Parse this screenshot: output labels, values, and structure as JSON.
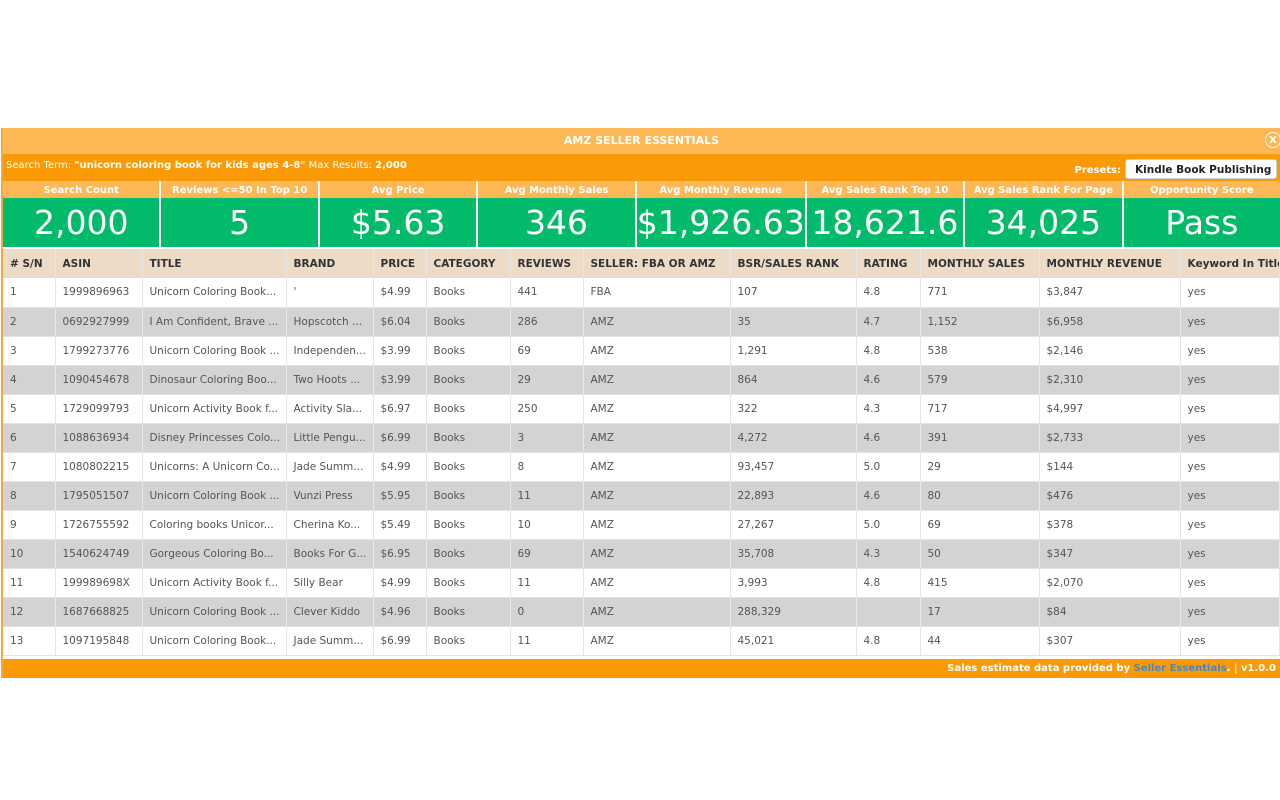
{
  "app": {
    "title": "AMZ SELLER ESSENTIALS",
    "close_label": "X"
  },
  "search": {
    "term_label": "Search Term: ",
    "term_value": "\"unicorn coloring book for kids ages 4-8\"",
    "max_label": " Max Results: ",
    "max_value": "2,000",
    "presets_label": "Presets:",
    "presets_value": "Kindle Book Publishing"
  },
  "stats": [
    {
      "label": "Search Count",
      "value": "2,000"
    },
    {
      "label": "Reviews <=50 In Top 10",
      "value": "5"
    },
    {
      "label": "Avg Price",
      "value": "$5.63"
    },
    {
      "label": "Avg Monthly Sales",
      "value": "346"
    },
    {
      "label": "Avg Monthly Revenue",
      "value": "$1,926.63"
    },
    {
      "label": "Avg Sales Rank Top 10",
      "value": "18,621.6"
    },
    {
      "label": "Avg Sales Rank For Page",
      "value": "34,025"
    },
    {
      "label": "Opportunity Score",
      "value": "Pass"
    }
  ],
  "table": {
    "columns": [
      "# S/N",
      "ASIN",
      "TITLE",
      "BRAND",
      "PRICE",
      "CATEGORY",
      "REVIEWS",
      "SELLER: FBA OR AMZ",
      "BSR/SALES RANK",
      "RATING",
      "MONTHLY SALES",
      "MONTHLY REVENUE",
      "Keyword In Title"
    ],
    "rows": [
      [
        "1",
        "1999896963",
        "Unicorn Coloring Book...",
        "'",
        "$4.99",
        "Books",
        "441",
        "FBA",
        "107",
        "4.8",
        "771",
        "$3,847",
        "yes"
      ],
      [
        "2",
        "0692927999",
        "I Am Confident, Brave ...",
        "Hopscotch ...",
        "$6.04",
        "Books",
        "286",
        "AMZ",
        "35",
        "4.7",
        "1,152",
        "$6,958",
        "yes"
      ],
      [
        "3",
        "1799273776",
        "Unicorn Coloring Book ...",
        "Independen...",
        "$3.99",
        "Books",
        "69",
        "AMZ",
        "1,291",
        "4.8",
        "538",
        "$2,146",
        "yes"
      ],
      [
        "4",
        "1090454678",
        "Dinosaur Coloring Boo...",
        "Two Hoots ...",
        "$3.99",
        "Books",
        "29",
        "AMZ",
        "864",
        "4.6",
        "579",
        "$2,310",
        "yes"
      ],
      [
        "5",
        "1729099793",
        "Unicorn Activity Book f...",
        "Activity Sla...",
        "$6.97",
        "Books",
        "250",
        "AMZ",
        "322",
        "4.3",
        "717",
        "$4,997",
        "yes"
      ],
      [
        "6",
        "1088636934",
        "Disney Princesses Colo...",
        "Little Pengu...",
        "$6.99",
        "Books",
        "3",
        "AMZ",
        "4,272",
        "4.6",
        "391",
        "$2,733",
        "yes"
      ],
      [
        "7",
        "1080802215",
        "Unicorns: A Unicorn Co...",
        "Jade Summ...",
        "$4.99",
        "Books",
        "8",
        "AMZ",
        "93,457",
        "5.0",
        "29",
        "$144",
        "yes"
      ],
      [
        "8",
        "1795051507",
        "Unicorn Coloring Book ...",
        "Vunzi Press",
        "$5.95",
        "Books",
        "11",
        "AMZ",
        "22,893",
        "4.6",
        "80",
        "$476",
        "yes"
      ],
      [
        "9",
        "1726755592",
        "Coloring books Unicor...",
        "Cherina Ko...",
        "$5.49",
        "Books",
        "10",
        "AMZ",
        "27,267",
        "5.0",
        "69",
        "$378",
        "yes"
      ],
      [
        "10",
        "1540624749",
        "Gorgeous Coloring Bo...",
        "Books For G...",
        "$6.95",
        "Books",
        "69",
        "AMZ",
        "35,708",
        "4.3",
        "50",
        "$347",
        "yes"
      ],
      [
        "11",
        "199989698X",
        "Unicorn Activity Book f...",
        "Silly Bear",
        "$4.99",
        "Books",
        "11",
        "AMZ",
        "3,993",
        "4.8",
        "415",
        "$2,070",
        "yes"
      ],
      [
        "12",
        "1687668825",
        "Unicorn Coloring Book ...",
        "Clever Kiddo",
        "$4.96",
        "Books",
        "0",
        "AMZ",
        "288,329",
        "",
        "17",
        "$84",
        "yes"
      ],
      [
        "13",
        "1097195848",
        "Unicorn Coloring Book...",
        "Jade Summ...",
        "$6.99",
        "Books",
        "11",
        "AMZ",
        "45,021",
        "4.8",
        "44",
        "$307",
        "yes"
      ]
    ]
  },
  "footer": {
    "text": "Sales estimate data provided by ",
    "link": "Seller Essentials",
    "suffix": ". | v1.0.0"
  },
  "colors": {
    "title_orange": "#fdb754",
    "bar_orange": "#fb9a07",
    "stat_green": "#02bb6a",
    "header_beige": "#ecdbc7",
    "row_gray": "#d3d3d3",
    "link_blue": "#4a86c5"
  }
}
